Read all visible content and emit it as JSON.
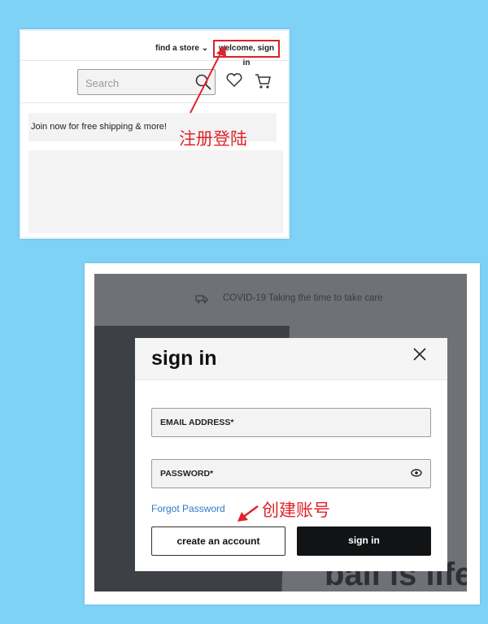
{
  "top_panel": {
    "find_store": "find a store",
    "welcome_sign_in": "welcome, sign in",
    "search_placeholder": "Search",
    "banner": "Join now for free shipping & more!",
    "annotation": "注册登陆"
  },
  "bottom_panel": {
    "covid_banner": "COVID-19 Taking the time to take care",
    "hero_text": "ball is life",
    "modal": {
      "title": "sign in",
      "email_label": "EMAIL ADDRESS*",
      "password_label": "PASSWORD*",
      "forgot_password": "Forgot Password",
      "create_account": "create an account",
      "sign_in": "sign in"
    },
    "annotation": "创建账号"
  },
  "colors": {
    "background": "#7ed2f6",
    "annotation_red": "#e0242c",
    "link_blue": "#2b7bcc",
    "primary_button": "#111315"
  }
}
